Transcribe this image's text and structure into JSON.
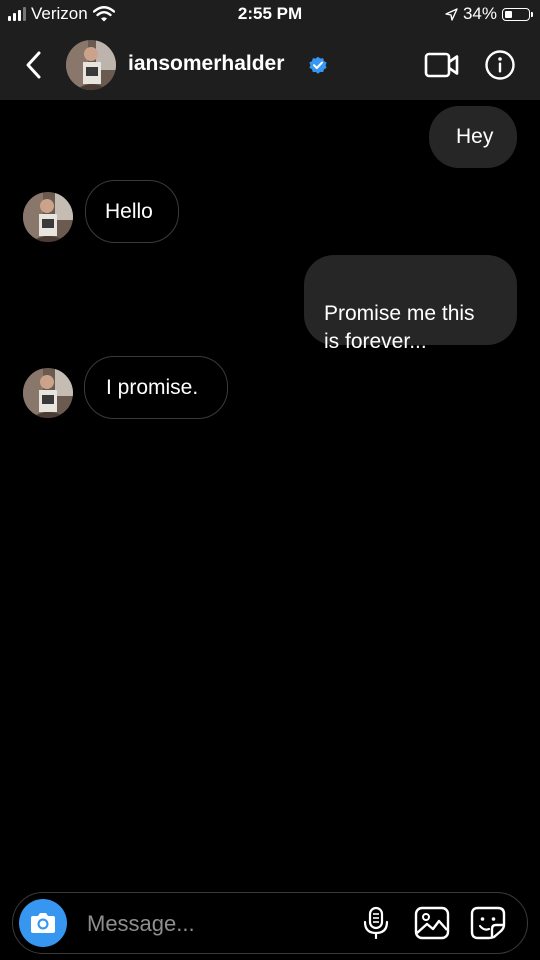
{
  "status_bar": {
    "carrier": "Verizon",
    "time": "2:55 PM",
    "battery_text": "34%",
    "battery_level": 0.34
  },
  "header": {
    "username": "iansomerhalder",
    "verified": true,
    "icons": [
      "back-chevron-icon",
      "verified-badge-icon",
      "video-call-icon",
      "info-icon"
    ]
  },
  "messages": [
    {
      "direction": "outgoing",
      "text": "Hey"
    },
    {
      "direction": "incoming",
      "text": "Hello"
    },
    {
      "direction": "outgoing",
      "text": "Promise me this\nis forever..."
    },
    {
      "direction": "incoming",
      "text": "I promise."
    }
  ],
  "composer": {
    "placeholder": "Message...",
    "icons": [
      "camera-icon",
      "microphone-icon",
      "gallery-icon",
      "sticker-icon"
    ]
  },
  "colors": {
    "header_bg": "#1e1e1e",
    "outgoing_bubble": "#262626",
    "accent_blue": "#3797f0",
    "verified_blue": "#3897f0"
  }
}
